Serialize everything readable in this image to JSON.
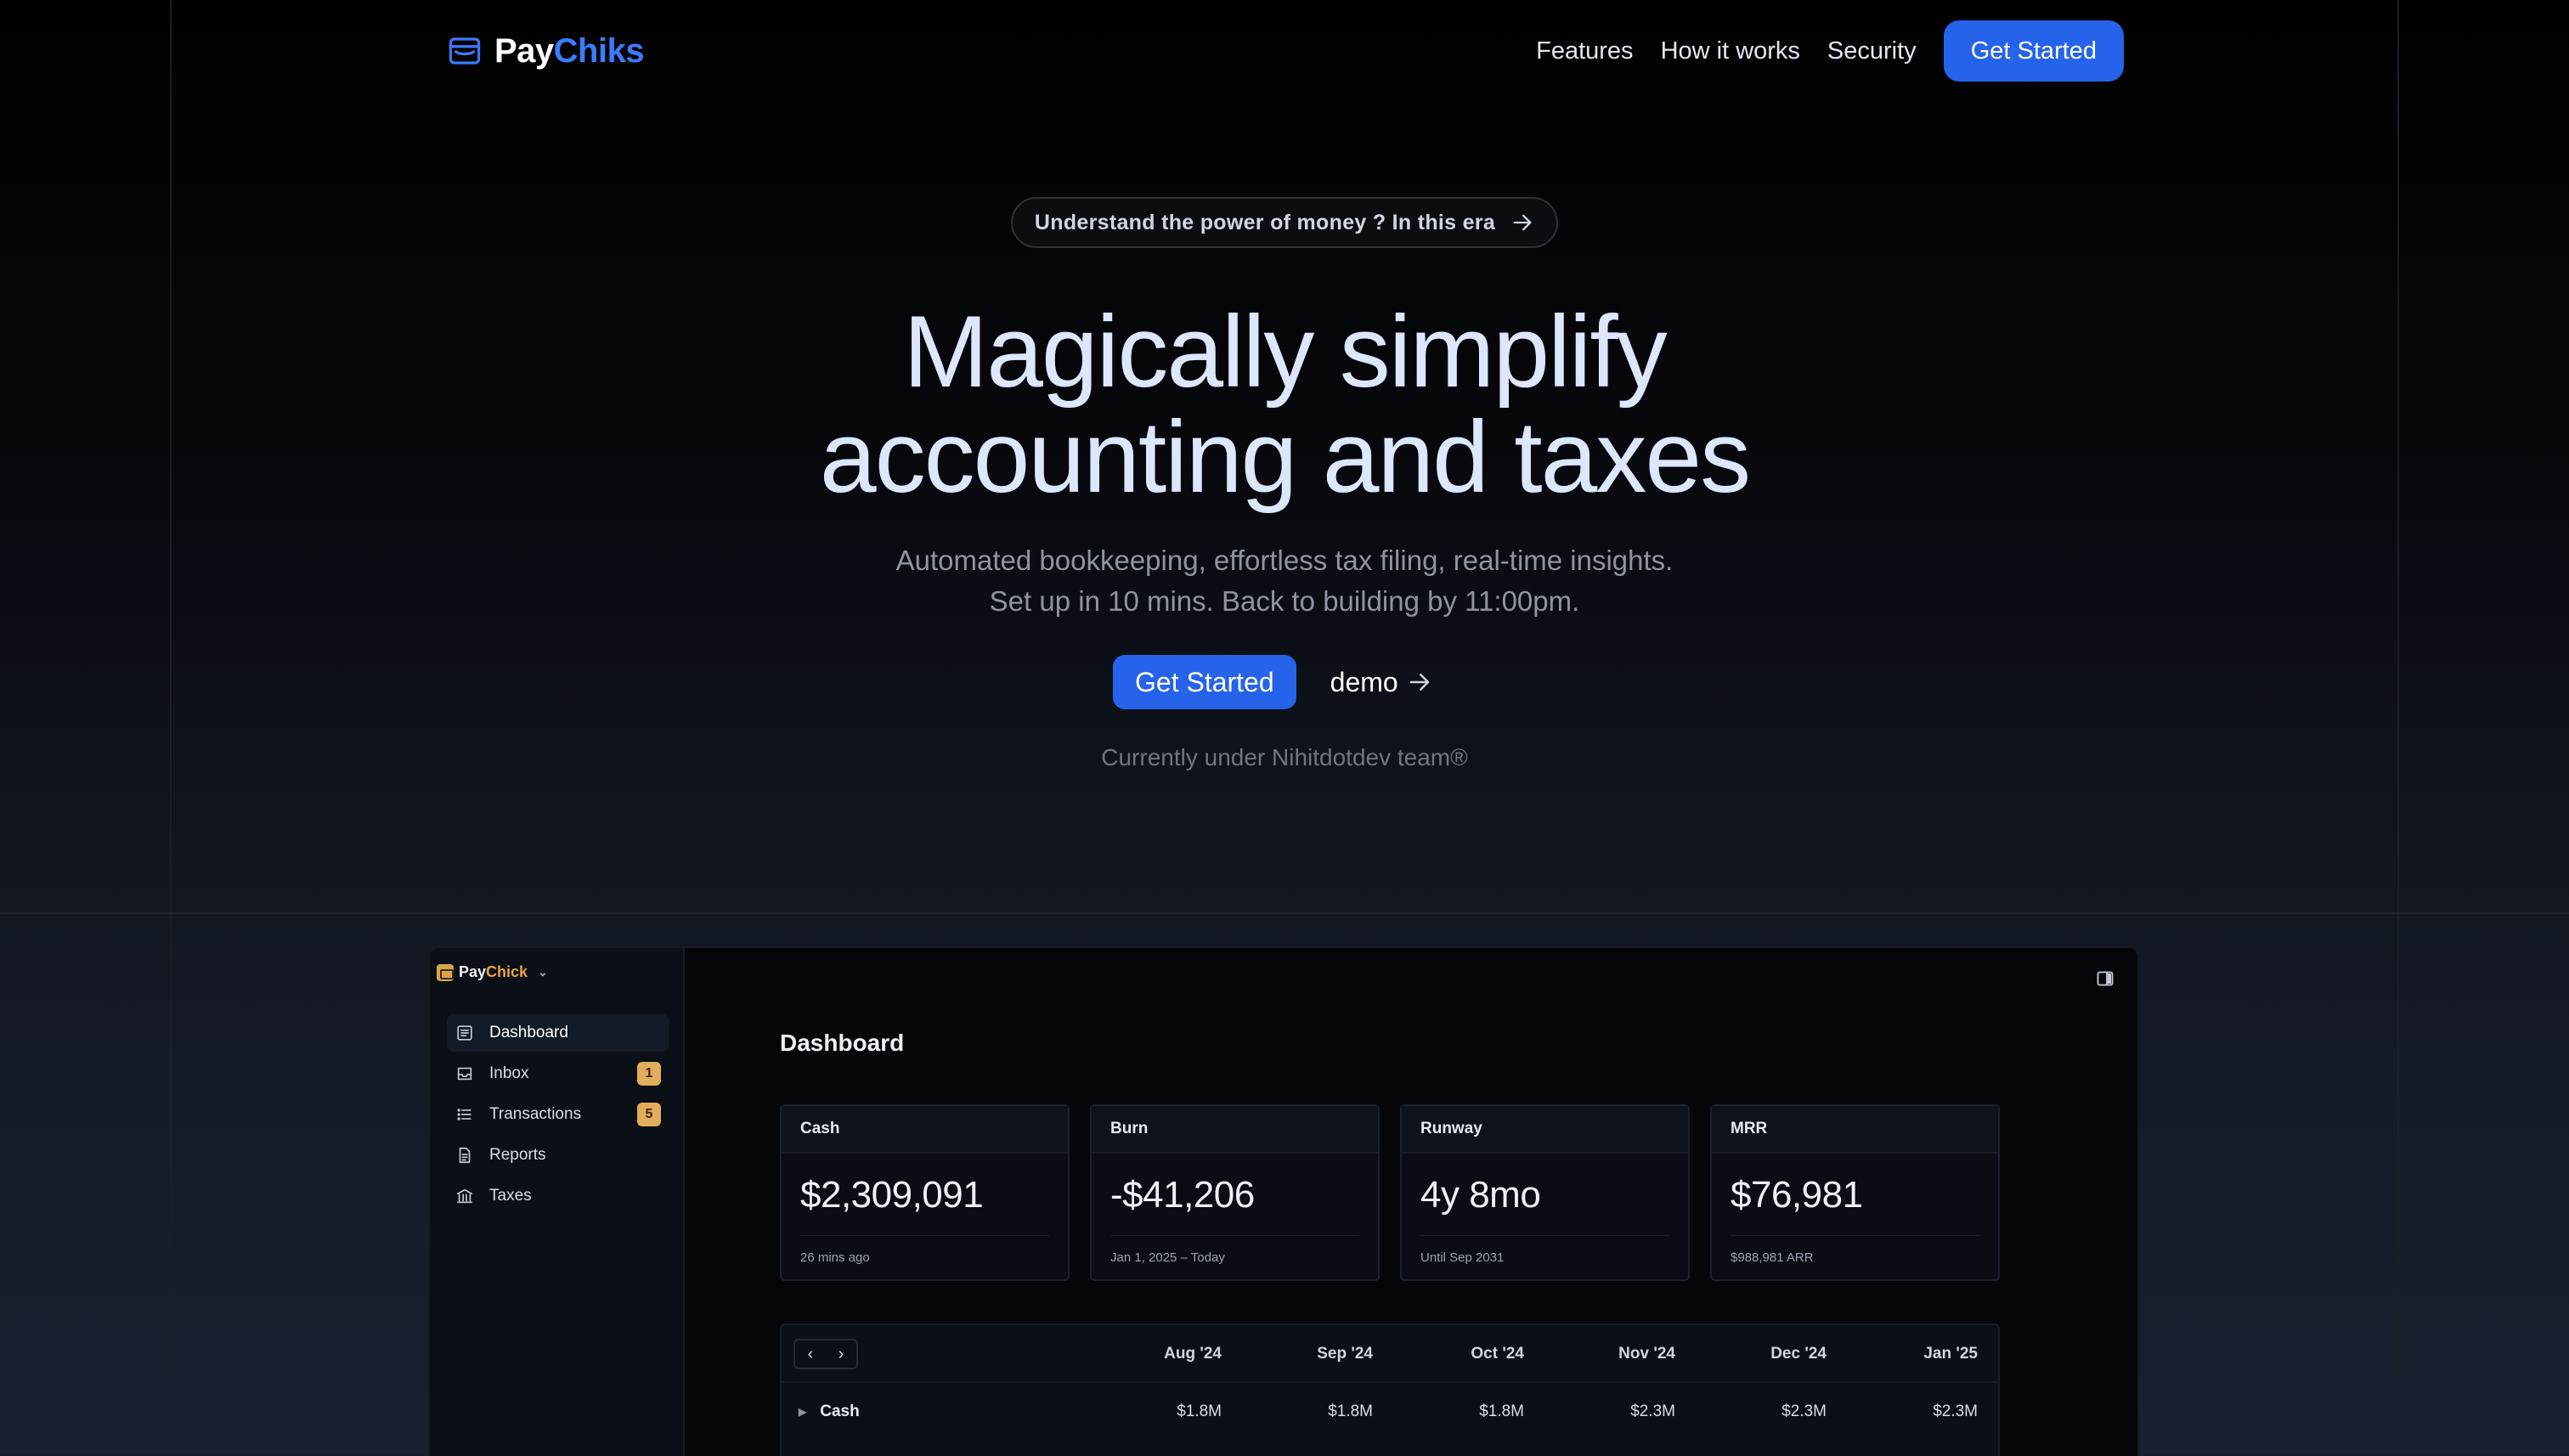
{
  "nav": {
    "brand_part1": "Pay",
    "brand_part2": "Chiks",
    "links": [
      "Features",
      "How it works",
      "Security"
    ],
    "cta": "Get Started",
    "brand_color": "#3b7bff",
    "button_color": "#2563eb"
  },
  "hero": {
    "pill_text": "Understand the power of money ? In this era",
    "title_line1": "Magically simplify",
    "title_line2": "accounting and taxes",
    "subtitle_line1": "Automated bookkeeping, effortless tax filing, real-time insights.",
    "subtitle_line2": "Set up in 10 mins. Back to building by 11:00pm.",
    "cta_primary": "Get Started",
    "cta_secondary": "demo",
    "note": "Currently under Nihitdotdev team®"
  },
  "app": {
    "brand_part1": "Pay",
    "brand_part2": "Chick",
    "sidebar": [
      {
        "label": "Dashboard",
        "icon": "dashboard-icon",
        "badge": null,
        "active": true
      },
      {
        "label": "Inbox",
        "icon": "inbox-icon",
        "badge": "1",
        "active": false
      },
      {
        "label": "Transactions",
        "icon": "list-icon",
        "badge": "5",
        "active": false
      },
      {
        "label": "Reports",
        "icon": "report-icon",
        "badge": null,
        "active": false
      },
      {
        "label": "Taxes",
        "icon": "bank-icon",
        "badge": null,
        "active": false
      }
    ],
    "page_title": "Dashboard",
    "cards": [
      {
        "title": "Cash",
        "value": "$2,309,091",
        "sub": "26 mins ago"
      },
      {
        "title": "Burn",
        "value": "-$41,206",
        "sub": "Jan 1, 2025 – Today"
      },
      {
        "title": "Runway",
        "value": "4y 8mo",
        "sub": "Until Sep 2031"
      },
      {
        "title": "MRR",
        "value": "$76,981",
        "sub": "$988,981 ARR"
      }
    ],
    "table": {
      "columns": [
        "Aug '24",
        "Sep '24",
        "Oct '24",
        "Nov '24",
        "Dec '24",
        "Jan '25"
      ],
      "rows": [
        {
          "label": "Cash",
          "values": [
            "$1.8M",
            "$1.8M",
            "$1.8M",
            "$2.3M",
            "$2.3M",
            "$2.3M"
          ]
        }
      ]
    }
  }
}
